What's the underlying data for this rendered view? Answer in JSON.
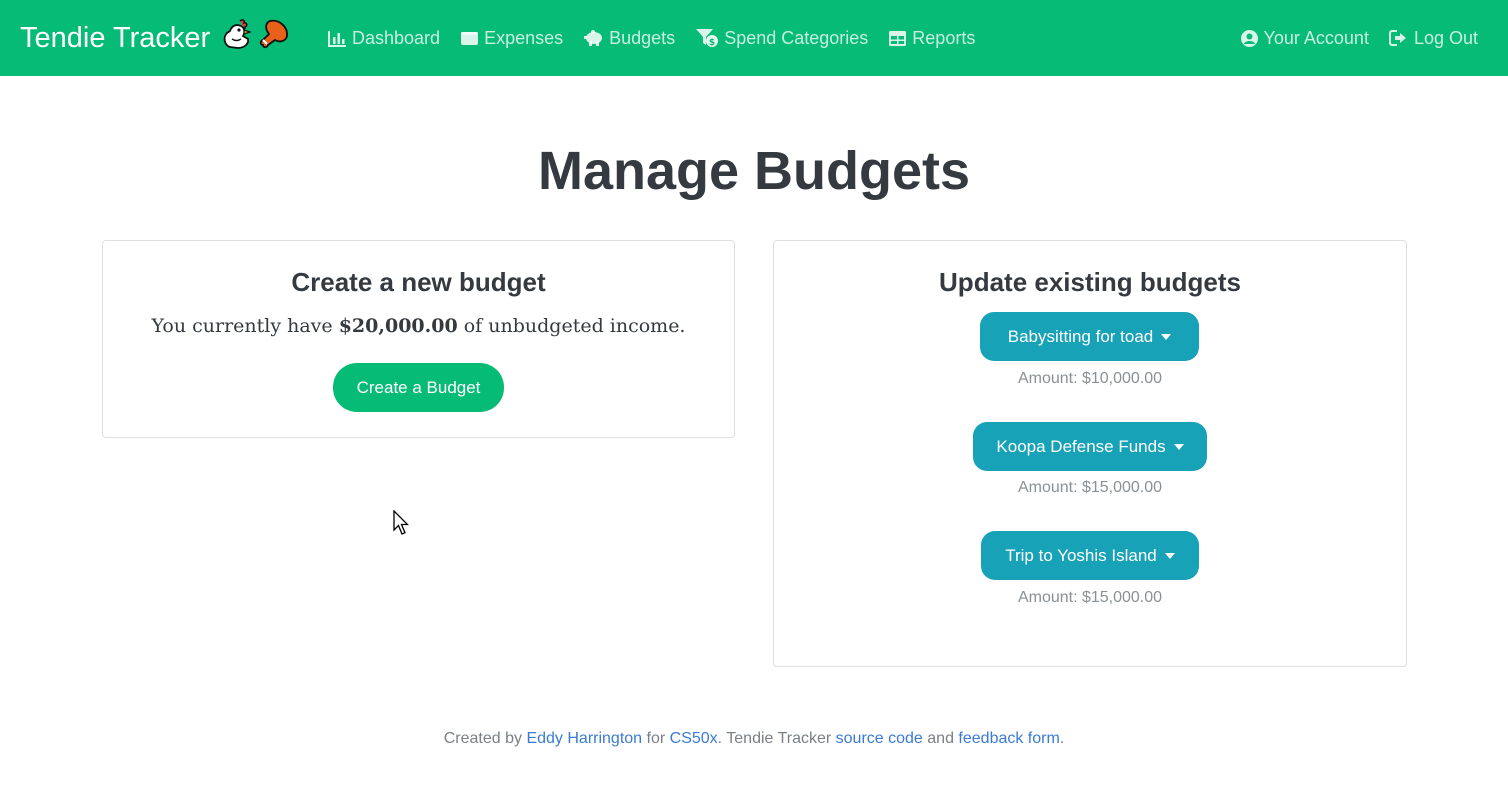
{
  "brand": {
    "title": "Tendie Tracker",
    "accent": "#06bb76"
  },
  "nav": {
    "left": [
      {
        "label": "Dashboard",
        "icon": "bar-chart-icon"
      },
      {
        "label": "Expenses",
        "icon": "wallet-icon"
      },
      {
        "label": "Budgets",
        "icon": "piggy-bank-icon"
      },
      {
        "label": "Spend Categories",
        "icon": "filter-dollar-icon"
      },
      {
        "label": "Reports",
        "icon": "table-icon"
      }
    ],
    "right": [
      {
        "label": "Your Account",
        "icon": "user-circle-icon"
      },
      {
        "label": "Log Out",
        "icon": "sign-out-icon"
      }
    ]
  },
  "page": {
    "title": "Manage Budgets"
  },
  "create": {
    "title": "Create a new budget",
    "income_prefix": "You currently have ",
    "income_amount": "$20,000.00",
    "income_suffix": " of unbudgeted income.",
    "button_label": "Create a Budget"
  },
  "update": {
    "title": "Update existing budgets",
    "budgets": [
      {
        "name": "Babysitting for toad",
        "amount": "Amount: $10,000.00"
      },
      {
        "name": "Koopa Defense Funds",
        "amount": "Amount: $15,000.00"
      },
      {
        "name": "Trip to Yoshis Island",
        "amount": "Amount: $15,000.00"
      }
    ]
  },
  "footer": {
    "t1": "Created by ",
    "author": "Eddy Harrington",
    "t2": " for ",
    "course": "CS50x",
    "t3": ". Tendie Tracker ",
    "source": "source code",
    "t4": " and ",
    "feedback": "feedback form",
    "t5": "."
  },
  "colors": {
    "teal": "#17a2b8",
    "link": "#3a7bd5",
    "muted": "#8a9096"
  }
}
